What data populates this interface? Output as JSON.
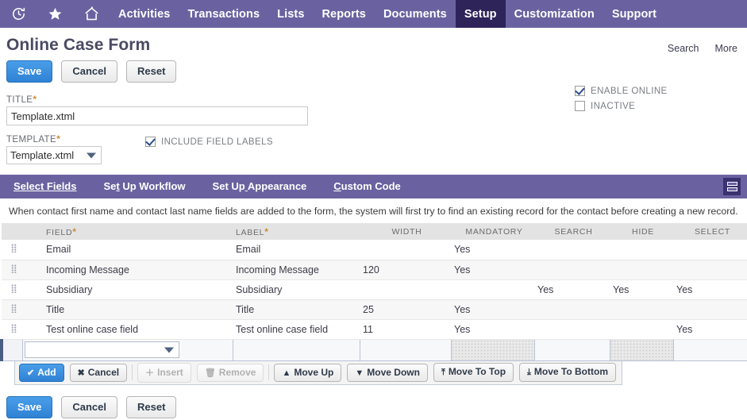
{
  "navbar": {
    "icons": [
      {
        "name": "recent-history-icon",
        "glyph": "↺"
      },
      {
        "name": "favorites-star-icon",
        "glyph": "★"
      },
      {
        "name": "home-icon",
        "glyph": "⌂"
      }
    ],
    "items": [
      {
        "label": "Activities",
        "active": false
      },
      {
        "label": "Transactions",
        "active": false
      },
      {
        "label": "Lists",
        "active": false
      },
      {
        "label": "Reports",
        "active": false
      },
      {
        "label": "Documents",
        "active": false
      },
      {
        "label": "Setup",
        "active": true
      },
      {
        "label": "Customization",
        "active": false
      },
      {
        "label": "Support",
        "active": false
      }
    ],
    "background_color": "#6a62a0",
    "active_color": "#2e2459"
  },
  "header": {
    "title": "Online Case Form",
    "links": [
      {
        "label": "Search"
      },
      {
        "label": "More"
      }
    ]
  },
  "top_buttons": {
    "save": "Save",
    "cancel": "Cancel",
    "reset": "Reset"
  },
  "form": {
    "title_label": "TITLE",
    "title_required": "*",
    "title_value": "Template.xtml",
    "title_placeholder": "",
    "template_label": "TEMPLATE",
    "template_required": "*",
    "template_value": "Template.xtml",
    "include_field_labels_label": "INCLUDE FIELD LABELS",
    "include_field_labels_checked": true,
    "enable_online_label": "ENABLE ONLINE",
    "enable_online_checked": true,
    "inactive_label": "INACTIVE",
    "inactive_checked": false
  },
  "subtabs": {
    "items": [
      {
        "label": "Select Fields",
        "accesskey_index": 0,
        "active": true
      },
      {
        "label": "Set Up Workflow",
        "accesskey_index": 2,
        "active": false
      },
      {
        "label": "Set Up Appearance",
        "accesskey_index": 6,
        "active": false
      },
      {
        "label": "Custom Code",
        "accesskey_index": 0,
        "active": false
      }
    ],
    "list_view_icon": "list-view-icon"
  },
  "note": "When contact first name and contact last name fields are added to the form, the system will first try to find an existing record for the contact before creating a new record.",
  "grid": {
    "columns": [
      {
        "label": "FIELD",
        "required": "*",
        "align": "left"
      },
      {
        "label": "LABEL",
        "required": "*",
        "align": "left"
      },
      {
        "label": "WIDTH",
        "required": "",
        "align": "center"
      },
      {
        "label": "MANDATORY",
        "required": "",
        "align": "center"
      },
      {
        "label": "SEARCH",
        "required": "",
        "align": "center"
      },
      {
        "label": "HIDE",
        "required": "",
        "align": "center"
      },
      {
        "label": "SELECT",
        "required": "",
        "align": "center"
      }
    ],
    "rows": [
      {
        "field": "Email",
        "label": "Email",
        "width": "",
        "mandatory": "Yes",
        "search": "",
        "hide": "",
        "select": ""
      },
      {
        "field": "Incoming Message",
        "label": "Incoming Message",
        "width": "120",
        "mandatory": "Yes",
        "search": "",
        "hide": "",
        "select": ""
      },
      {
        "field": "Subsidiary",
        "label": "Subsidiary",
        "width": "",
        "mandatory": "",
        "search": "Yes",
        "hide": "Yes",
        "select": "Yes"
      },
      {
        "field": "Title",
        "label": "Title",
        "width": "25",
        "mandatory": "Yes",
        "search": "",
        "hide": "",
        "select": ""
      },
      {
        "field": "Test online case field",
        "label": "Test online case field",
        "width": "11",
        "mandatory": "Yes",
        "search": "",
        "hide": "",
        "select": "Yes"
      }
    ],
    "edit_row": {
      "field_value": "",
      "label_value": "",
      "width_value": "",
      "mandatory_value": "",
      "search_value": "",
      "hide_value": "",
      "select_value": ""
    }
  },
  "grid_toolbar": {
    "add": "Add",
    "cancel": "Cancel",
    "insert": "Insert",
    "remove": "Remove",
    "move_up": "Move Up",
    "move_down": "Move Down",
    "move_to_top": "Move To Top",
    "move_to_bottom": "Move To Bottom",
    "add_icon": "✔",
    "cancel_icon": "✖",
    "insert_icon": "＋",
    "remove_icon": "🗑",
    "move_up_icon": "▲",
    "move_down_icon": "▼",
    "move_to_top_icon": "⤒",
    "move_to_bottom_icon": "⤓"
  },
  "bottom_buttons": {
    "save": "Save",
    "cancel": "Cancel",
    "reset": "Reset"
  }
}
